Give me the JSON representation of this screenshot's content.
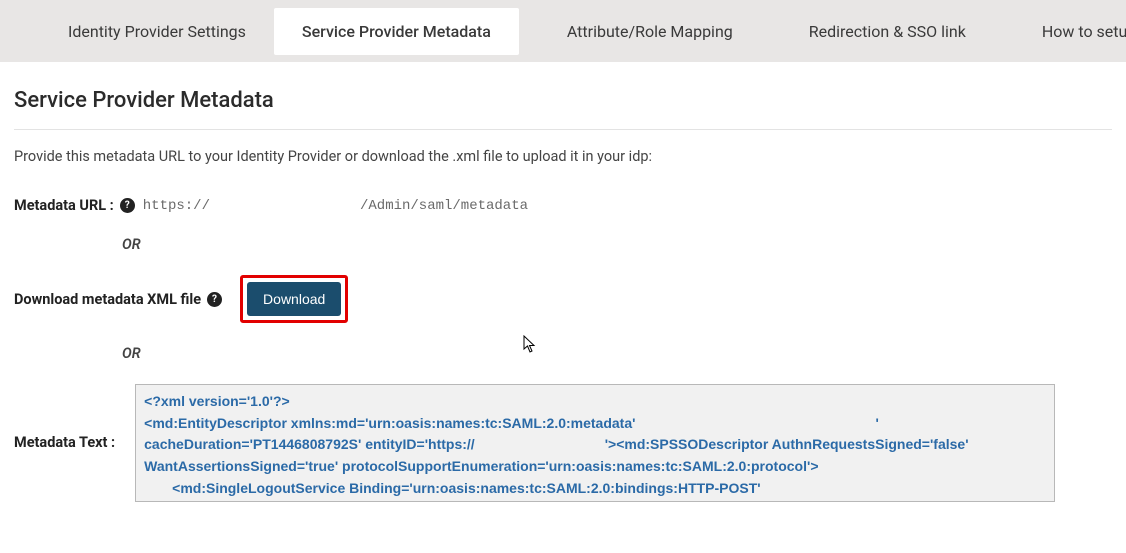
{
  "tabs": {
    "idp_settings": "Identity Provider Settings",
    "sp_metadata": "Service Provider Metadata",
    "attr_mapping": "Attribute/Role Mapping",
    "redirection": "Redirection & SSO link",
    "howto": "How to setup ?"
  },
  "page": {
    "title": "Service Provider Metadata",
    "intro": "Provide this metadata URL to your Identity Provider or download the .xml file to upload it in your idp:"
  },
  "metadata_url": {
    "label": "Metadata URL :",
    "prefix": "https://",
    "suffix": "/Admin/saml/metadata"
  },
  "separator": "OR",
  "download": {
    "label": "Download metadata XML file",
    "button": "Download"
  },
  "metadata_text": {
    "label": "Metadata Text :",
    "line1": "<?xml version='1.0'?>",
    "line2_a": "<md:EntityDescriptor xmlns:md='urn:oasis:names:tc:SAML:2.0:metadata'",
    "line2_b": "'",
    "line3_a": "cacheDuration='PT1446808792S' entityID='https://",
    "line3_b": "'><md:SPSSODescriptor AuthnRequestsSigned='false'",
    "line4": "WantAssertionsSigned='true' protocolSupportEnumeration='urn:oasis:names:tc:SAML:2.0:protocol'>",
    "line5": "<md:SingleLogoutService Binding='urn:oasis:names:tc:SAML:2.0:bindings:HTTP-POST'"
  }
}
